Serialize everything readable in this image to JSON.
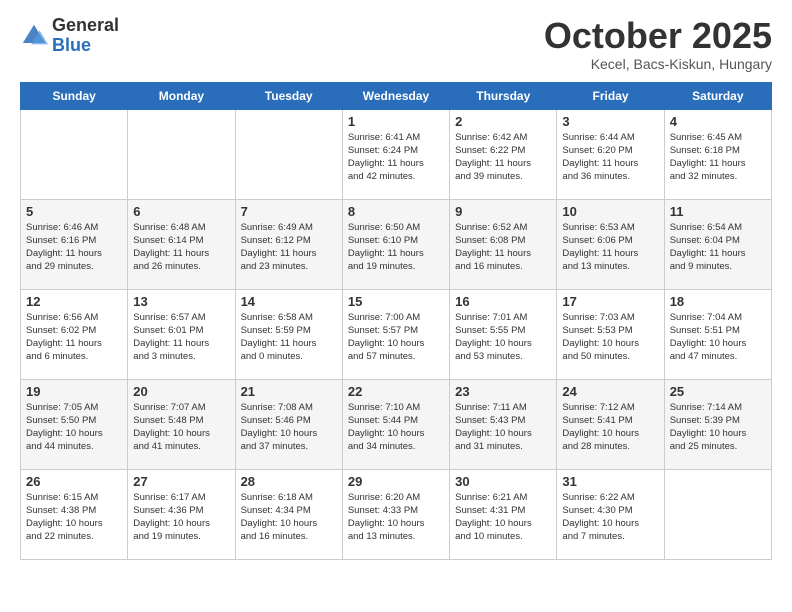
{
  "header": {
    "logo_general": "General",
    "logo_blue": "Blue",
    "title": "October 2025",
    "subtitle": "Kecel, Bacs-Kiskun, Hungary"
  },
  "weekdays": [
    "Sunday",
    "Monday",
    "Tuesday",
    "Wednesday",
    "Thursday",
    "Friday",
    "Saturday"
  ],
  "weeks": [
    [
      {
        "day": "",
        "info": ""
      },
      {
        "day": "",
        "info": ""
      },
      {
        "day": "",
        "info": ""
      },
      {
        "day": "1",
        "info": "Sunrise: 6:41 AM\nSunset: 6:24 PM\nDaylight: 11 hours\nand 42 minutes."
      },
      {
        "day": "2",
        "info": "Sunrise: 6:42 AM\nSunset: 6:22 PM\nDaylight: 11 hours\nand 39 minutes."
      },
      {
        "day": "3",
        "info": "Sunrise: 6:44 AM\nSunset: 6:20 PM\nDaylight: 11 hours\nand 36 minutes."
      },
      {
        "day": "4",
        "info": "Sunrise: 6:45 AM\nSunset: 6:18 PM\nDaylight: 11 hours\nand 32 minutes."
      }
    ],
    [
      {
        "day": "5",
        "info": "Sunrise: 6:46 AM\nSunset: 6:16 PM\nDaylight: 11 hours\nand 29 minutes."
      },
      {
        "day": "6",
        "info": "Sunrise: 6:48 AM\nSunset: 6:14 PM\nDaylight: 11 hours\nand 26 minutes."
      },
      {
        "day": "7",
        "info": "Sunrise: 6:49 AM\nSunset: 6:12 PM\nDaylight: 11 hours\nand 23 minutes."
      },
      {
        "day": "8",
        "info": "Sunrise: 6:50 AM\nSunset: 6:10 PM\nDaylight: 11 hours\nand 19 minutes."
      },
      {
        "day": "9",
        "info": "Sunrise: 6:52 AM\nSunset: 6:08 PM\nDaylight: 11 hours\nand 16 minutes."
      },
      {
        "day": "10",
        "info": "Sunrise: 6:53 AM\nSunset: 6:06 PM\nDaylight: 11 hours\nand 13 minutes."
      },
      {
        "day": "11",
        "info": "Sunrise: 6:54 AM\nSunset: 6:04 PM\nDaylight: 11 hours\nand 9 minutes."
      }
    ],
    [
      {
        "day": "12",
        "info": "Sunrise: 6:56 AM\nSunset: 6:02 PM\nDaylight: 11 hours\nand 6 minutes."
      },
      {
        "day": "13",
        "info": "Sunrise: 6:57 AM\nSunset: 6:01 PM\nDaylight: 11 hours\nand 3 minutes."
      },
      {
        "day": "14",
        "info": "Sunrise: 6:58 AM\nSunset: 5:59 PM\nDaylight: 11 hours\nand 0 minutes."
      },
      {
        "day": "15",
        "info": "Sunrise: 7:00 AM\nSunset: 5:57 PM\nDaylight: 10 hours\nand 57 minutes."
      },
      {
        "day": "16",
        "info": "Sunrise: 7:01 AM\nSunset: 5:55 PM\nDaylight: 10 hours\nand 53 minutes."
      },
      {
        "day": "17",
        "info": "Sunrise: 7:03 AM\nSunset: 5:53 PM\nDaylight: 10 hours\nand 50 minutes."
      },
      {
        "day": "18",
        "info": "Sunrise: 7:04 AM\nSunset: 5:51 PM\nDaylight: 10 hours\nand 47 minutes."
      }
    ],
    [
      {
        "day": "19",
        "info": "Sunrise: 7:05 AM\nSunset: 5:50 PM\nDaylight: 10 hours\nand 44 minutes."
      },
      {
        "day": "20",
        "info": "Sunrise: 7:07 AM\nSunset: 5:48 PM\nDaylight: 10 hours\nand 41 minutes."
      },
      {
        "day": "21",
        "info": "Sunrise: 7:08 AM\nSunset: 5:46 PM\nDaylight: 10 hours\nand 37 minutes."
      },
      {
        "day": "22",
        "info": "Sunrise: 7:10 AM\nSunset: 5:44 PM\nDaylight: 10 hours\nand 34 minutes."
      },
      {
        "day": "23",
        "info": "Sunrise: 7:11 AM\nSunset: 5:43 PM\nDaylight: 10 hours\nand 31 minutes."
      },
      {
        "day": "24",
        "info": "Sunrise: 7:12 AM\nSunset: 5:41 PM\nDaylight: 10 hours\nand 28 minutes."
      },
      {
        "day": "25",
        "info": "Sunrise: 7:14 AM\nSunset: 5:39 PM\nDaylight: 10 hours\nand 25 minutes."
      }
    ],
    [
      {
        "day": "26",
        "info": "Sunrise: 6:15 AM\nSunset: 4:38 PM\nDaylight: 10 hours\nand 22 minutes."
      },
      {
        "day": "27",
        "info": "Sunrise: 6:17 AM\nSunset: 4:36 PM\nDaylight: 10 hours\nand 19 minutes."
      },
      {
        "day": "28",
        "info": "Sunrise: 6:18 AM\nSunset: 4:34 PM\nDaylight: 10 hours\nand 16 minutes."
      },
      {
        "day": "29",
        "info": "Sunrise: 6:20 AM\nSunset: 4:33 PM\nDaylight: 10 hours\nand 13 minutes."
      },
      {
        "day": "30",
        "info": "Sunrise: 6:21 AM\nSunset: 4:31 PM\nDaylight: 10 hours\nand 10 minutes."
      },
      {
        "day": "31",
        "info": "Sunrise: 6:22 AM\nSunset: 4:30 PM\nDaylight: 10 hours\nand 7 minutes."
      },
      {
        "day": "",
        "info": ""
      }
    ]
  ]
}
